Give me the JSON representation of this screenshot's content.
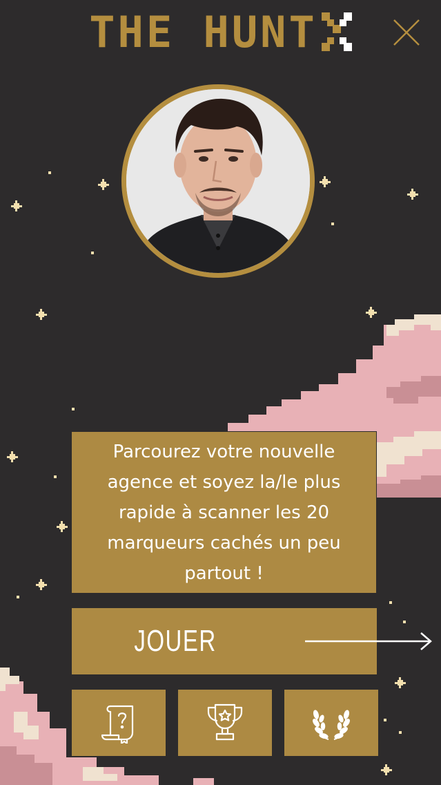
{
  "app": {
    "logo_text": "THE HUNT",
    "logo_mark": "x-icon"
  },
  "header": {
    "close_icon": "close-icon"
  },
  "intro": {
    "message": "Parcourez votre nouvelle agence et soyez la/le plus rapide à scanner les 20 marqueurs cachés un peu partout !"
  },
  "actions": {
    "play_label": "JOUER",
    "play_icon": "arrow-right-icon",
    "rules_icon": "scroll-question-icon",
    "leaderboard_icon": "trophy-icon",
    "rewards_icon": "laurel-icon"
  },
  "colors": {
    "background": "#2d2b2c",
    "gold": "#ad8a43",
    "logo_gold": "#b48e3f",
    "cloud_pink": "#e8b1b6",
    "cloud_light": "#f0e2d0",
    "star": "#f3dfae"
  }
}
